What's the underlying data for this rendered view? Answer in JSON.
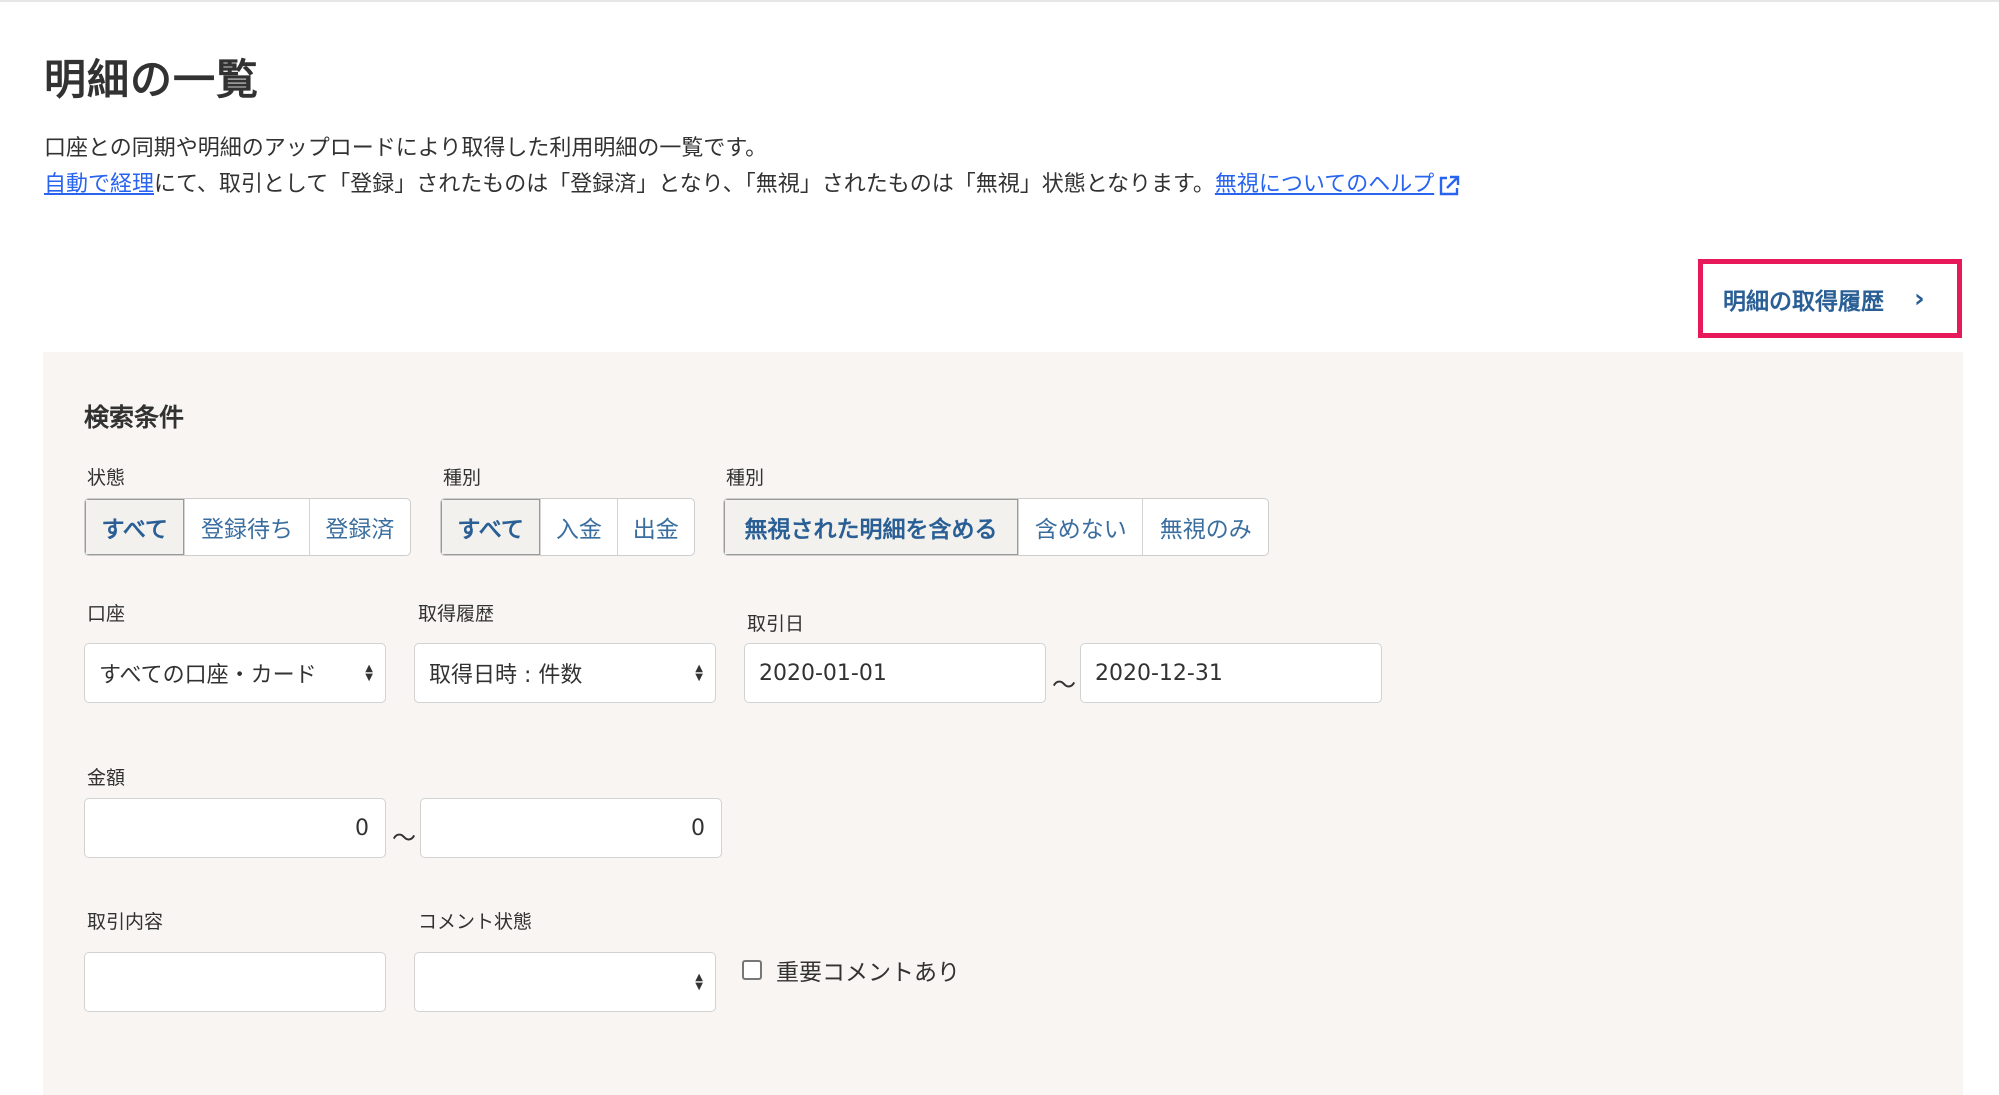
{
  "page": {
    "title": "明細の一覧",
    "description_line1": "口座との同期や明細のアップロードにより取得した利用明細の一覧です。",
    "description_link1": "自動で経理",
    "description_line2": "にて、取引として「登録」されたものは「登録済」となり、「無視」されたものは「無視」状態となります。",
    "description_link2": "無視についてのヘルプ",
    "external_icon": "external-link-icon"
  },
  "history_link": {
    "label": "明細の取得履歴",
    "icon": "chevron-right-icon",
    "highlight_color": "#e8195a"
  },
  "search": {
    "title": "検索条件",
    "status": {
      "label": "状態",
      "options": [
        "すべて",
        "登録待ち",
        "登録済"
      ],
      "selected": "すべて"
    },
    "type1": {
      "label": "種別",
      "options": [
        "すべて",
        "入金",
        "出金"
      ],
      "selected": "すべて"
    },
    "type2": {
      "label": "種別",
      "options": [
        "無視された明細を含める",
        "含めない",
        "無視のみ"
      ],
      "selected": "無視された明細を含める"
    },
    "account": {
      "label": "口座",
      "value": "すべての口座・カード"
    },
    "history": {
      "label": "取得履歴",
      "value": "取得日時 : 件数"
    },
    "date": {
      "label": "取引日",
      "from": "2020-01-01",
      "to": "2020-12-31"
    },
    "amount": {
      "label": "金額",
      "from": "0",
      "to": "0"
    },
    "content": {
      "label": "取引内容",
      "value": ""
    },
    "comment_status": {
      "label": "コメント状態",
      "value": ""
    },
    "important": {
      "label": "重要コメントあり",
      "checked": false
    },
    "range_sep": "～"
  },
  "colors": {
    "link": "#2864f0",
    "accent": "#2a5f96",
    "panel_bg": "#f8f5f2"
  }
}
